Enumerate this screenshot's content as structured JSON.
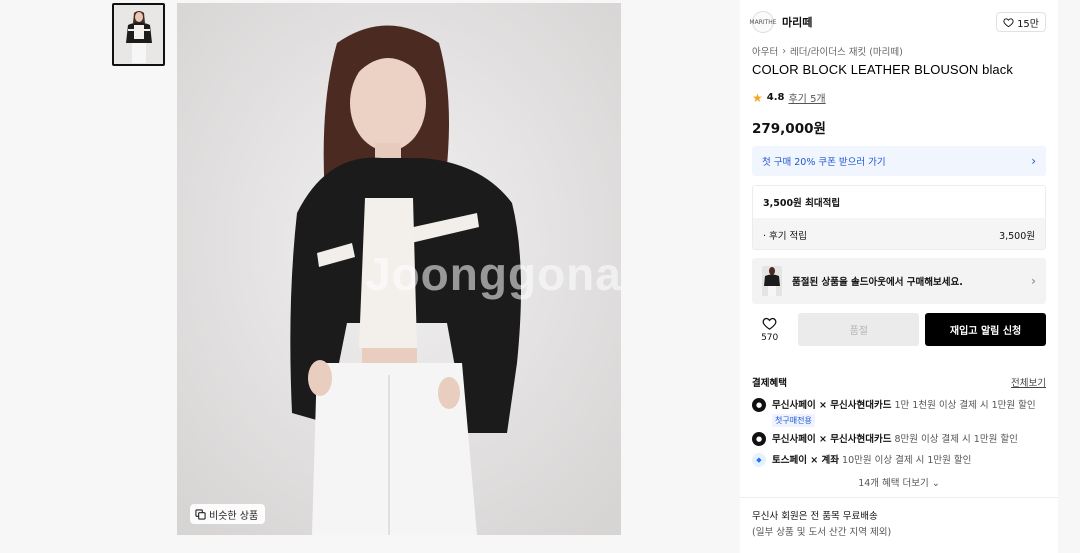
{
  "gallery": {
    "watermark": "Joonggonara",
    "similar_label": "비슷한 상품"
  },
  "brand": {
    "logo_text": "MARITHE",
    "name": "마리떼",
    "likes": "15만"
  },
  "breadcrumb": {
    "level1": "아우터",
    "separator": "›",
    "level2": "레더/라이더스 재킷 (마리떼)"
  },
  "product": {
    "title": "COLOR BLOCK LEATHER BLOUSON black",
    "rating": "4.8",
    "review_link": "후기 5개",
    "price": "279,000원"
  },
  "coupon": {
    "label": "첫 구매 20% 쿠폰 받으러 가기"
  },
  "points": {
    "header": "3,500원 최대적립",
    "row_label": "· 후기 적립",
    "row_value": "3,500원"
  },
  "soldout_banner": {
    "label": "품절된 상품을 솔드아웃에서 구매해보세요."
  },
  "actions": {
    "like_count": "570",
    "soldout_label": "품절",
    "restock_label": "재입고 알림 신청"
  },
  "benefits": {
    "title": "결제혜택",
    "view_all": "전체보기",
    "items": [
      {
        "brand": "무신사페이 × 무신사현대카드",
        "desc": " 1만 1천원 이상 결제 시 1만원 할인",
        "tag": "첫구매전용"
      },
      {
        "brand": "무신사페이 × 무신사현대카드",
        "desc": " 8만원 이상 결제 시 1만원 할인"
      },
      {
        "brand": "토스페이 × 계좌",
        "desc": " 10만원 이상 결제 시 1만원 할인"
      }
    ],
    "more": "14개 혜택 더보기"
  },
  "shipping": {
    "line1": "무신사 회원은 전 품목 무료배송",
    "line2": "(일부 상품 및 도서 산간 지역 제외)"
  },
  "colors": {
    "coupon_blue": "#1f57d6",
    "star": "#f5a623",
    "restock_bg": "#000000"
  }
}
